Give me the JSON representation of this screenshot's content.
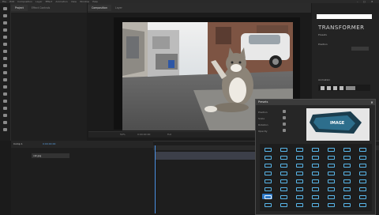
{
  "menubar": {
    "items": [
      "File",
      "Edit",
      "Composition",
      "Layer",
      "Effect",
      "Animation",
      "View",
      "Window",
      "Help"
    ],
    "window_controls": [
      "–",
      "▢",
      "✕"
    ]
  },
  "project_panel": {
    "tabs": [
      "Project",
      "Effect Controls"
    ]
  },
  "composition_panel": {
    "tabs": [
      "Composition",
      "Layer"
    ],
    "zoom": "50%",
    "timecode": "0:00:00:00",
    "quality": "Full"
  },
  "right_panel": {
    "title": "TRANSFORMER",
    "section1": "Presets",
    "section2": "Position",
    "section3": "Animation"
  },
  "timeline": {
    "tab": "Comp 1",
    "timecode": "0:00:00:00",
    "layer_name": "cat.jpg"
  },
  "dialog": {
    "title": "Presets",
    "preview_text": "IMAGE",
    "options": [
      "Position",
      "Scale",
      "Rotation",
      "Opacity"
    ]
  },
  "colors": {
    "accent": "#2f79c7",
    "icon_blue": "#59b7ea",
    "track": "#3c3f49"
  }
}
